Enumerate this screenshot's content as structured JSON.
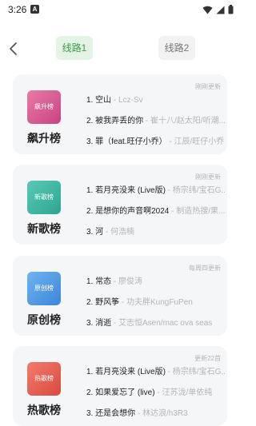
{
  "status_bar": {
    "time": "3:26",
    "notification_label": "A",
    "wifi_icon": "wifi-icon",
    "signal_icon": "cell-signal-icon",
    "battery_icon": "battery-icon"
  },
  "header": {
    "back_icon": "back-arrow-icon",
    "tabs": [
      {
        "label": "线路1",
        "selected": true
      },
      {
        "label": "线路2",
        "selected": false
      }
    ]
  },
  "charts": [
    {
      "badge_text": "飙升榜",
      "name": "飙升榜",
      "update_text": "刚刚更新",
      "songs": [
        {
          "title": "1. 空山",
          "artist": " - Lcz-Sv"
        },
        {
          "title": "2. 被我弄丢的你",
          "artist": " - 崔十八/赵太阳/听潮..."
        },
        {
          "title": "3. 罪（feat.旺仔小乔）",
          "artist": " - 江辰/旺仔小乔"
        }
      ]
    },
    {
      "badge_text": "新歌榜",
      "name": "新歌榜",
      "update_text": "刚刚更新",
      "songs": [
        {
          "title": "1. 若月亮没来 (Live版)",
          "artist": " - 杨宗纬/宝石G..."
        },
        {
          "title": "2. 是想你的声音啊2024",
          "artist": " - 制造热搜/果..."
        },
        {
          "title": "3. 河",
          "artist": " - 何浩楠"
        }
      ]
    },
    {
      "badge_text": "原创榜",
      "name": "原创榜",
      "update_text": "每周四更新",
      "songs": [
        {
          "title": "1. 常态",
          "artist": " - 廖俊涛"
        },
        {
          "title": "2. 野风筝",
          "artist": " - 功夫胖KungFuPen"
        },
        {
          "title": "3. 消逝",
          "artist": " - 艾志恒Asen/mac ova seas"
        }
      ]
    },
    {
      "badge_text": "热歌榜",
      "name": "热歌榜",
      "update_text": "更新22首",
      "songs": [
        {
          "title": "1. 若月亮没来 (Live版)",
          "artist": " - 杨宗纬/宝石G..."
        },
        {
          "title": "2. 如果爱忘了 (live)",
          "artist": " - 汪苏泷/单依纯"
        },
        {
          "title": "3. 还是会想你",
          "artist": " - 林达浪/h3R3"
        }
      ]
    }
  ]
}
